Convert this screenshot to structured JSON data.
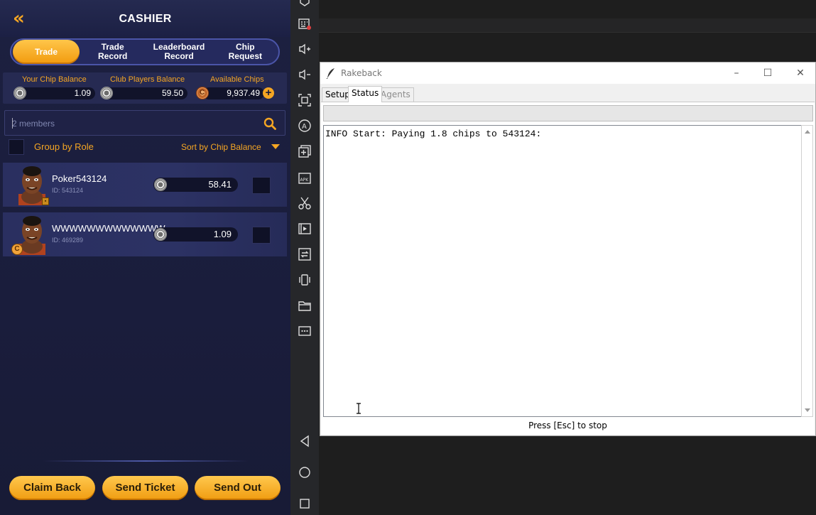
{
  "cashier": {
    "title": "CASHIER",
    "back_icon": "double-chevron-left-icon",
    "tabs": [
      {
        "label": "Trade",
        "active": true
      },
      {
        "label": "Trade\nRecord",
        "active": false
      },
      {
        "label": "Leaderboard\nRecord",
        "active": false
      },
      {
        "label": "Chip\nRequest",
        "active": false
      }
    ],
    "balances": {
      "your_chip_label": "Your Chip Balance",
      "your_chip_value": "1.09",
      "club_players_label": "Club Players Balance",
      "club_players_value": "59.50",
      "available_label": "Available Chips",
      "available_value": "9,937.49"
    },
    "search": {
      "placeholder": "2 members"
    },
    "group_by_role": "Group by Role",
    "sort_label": "Sort by Chip Balance",
    "members": [
      {
        "name": "Poker543124",
        "id": "ID: 543124",
        "balance": "58.41"
      },
      {
        "name": "WWWWWWWWWWWWW",
        "id": "ID: 469289",
        "balance": "1.09",
        "badge": "C"
      }
    ],
    "buttons": {
      "claim_back": "Claim Back",
      "send_ticket": "Send Ticket",
      "send_out": "Send Out"
    },
    "colors": {
      "accent": "#f5a623",
      "panel": "#1c2040"
    }
  },
  "toolbar": {
    "icons": [
      "multi-instance-icon",
      "volume-up-icon",
      "volume-down-icon",
      "fullscreen-icon",
      "auto-rotate-icon",
      "add-instance-icon",
      "apk-install-icon",
      "scissors-icon",
      "media-icon",
      "sync-icon",
      "shake-icon",
      "folder-icon",
      "more-icon",
      "back-nav-icon",
      "home-nav-icon",
      "recents-nav-icon"
    ]
  },
  "rakeback": {
    "title": "Rakeback",
    "tabs": [
      {
        "label": "Setup"
      },
      {
        "label": "Status",
        "selected": true
      },
      {
        "label": "Agents",
        "disabled": true
      }
    ],
    "log": "INFO Start: Paying 1.8 chips to 543124:",
    "status": "Press [Esc] to stop"
  }
}
